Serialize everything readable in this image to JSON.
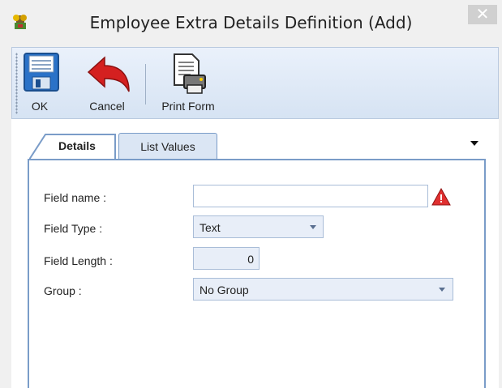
{
  "window": {
    "title": "Employee Extra Details Definition (Add)",
    "close_symbol": "✕"
  },
  "toolbar": {
    "ok_label": "OK",
    "cancel_label": "Cancel",
    "print_label": "Print Form"
  },
  "tabs": [
    {
      "label": "Details",
      "active": true
    },
    {
      "label": "List Values",
      "active": false
    }
  ],
  "form": {
    "field_name": {
      "label": "Field name :",
      "value": ""
    },
    "field_type": {
      "label": "Field Type :",
      "value": "Text"
    },
    "field_length": {
      "label": "Field Length :",
      "value": "0"
    },
    "group": {
      "label": "Group :",
      "value": "No Group"
    }
  },
  "colors": {
    "accent": "#7a9cc8",
    "toolbar_top": "#eaf1fb",
    "toolbar_bottom": "#d6e3f3",
    "warning": "#e03030"
  },
  "icons": [
    "app-icon",
    "save-icon",
    "undo-arrow-icon",
    "print-icon",
    "warning-icon",
    "close-icon",
    "chevron-down-icon"
  ]
}
